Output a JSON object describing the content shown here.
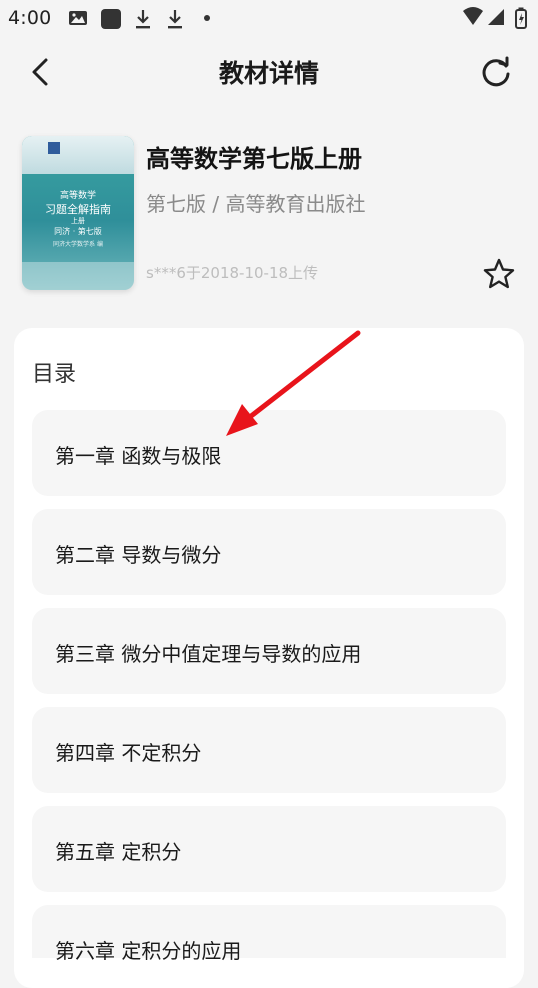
{
  "status_bar": {
    "time": "4:00"
  },
  "header": {
    "title": "教材详情",
    "back_icon": "chevron-left-icon",
    "refresh_icon": "refresh-icon"
  },
  "book": {
    "title": "高等数学第七版上册",
    "edition_publisher": "第七版 / 高等教育出版社",
    "upload_info": "s***6于2018-10-18上传",
    "favorite_icon": "star-outline-icon",
    "cover": {
      "line1": "高等数学",
      "line2": "习题全解指南",
      "line3": "上册",
      "line4": "同济 · 第七版",
      "line5": "同济大学数学系 编"
    }
  },
  "toc": {
    "heading": "目录",
    "chapters": [
      {
        "label": "第一章 函数与极限"
      },
      {
        "label": "第二章 导数与微分"
      },
      {
        "label": "第三章 微分中值定理与导数的应用"
      },
      {
        "label": "第四章 不定积分"
      },
      {
        "label": "第五章 定积分"
      },
      {
        "label": "第六章 定积分的应用"
      }
    ]
  },
  "colors": {
    "background": "#f4f4f4",
    "card": "#ffffff",
    "chapter_bg": "#f6f6f6",
    "annotation": "#e8141b",
    "cover_teal": "#3aa4a2"
  }
}
